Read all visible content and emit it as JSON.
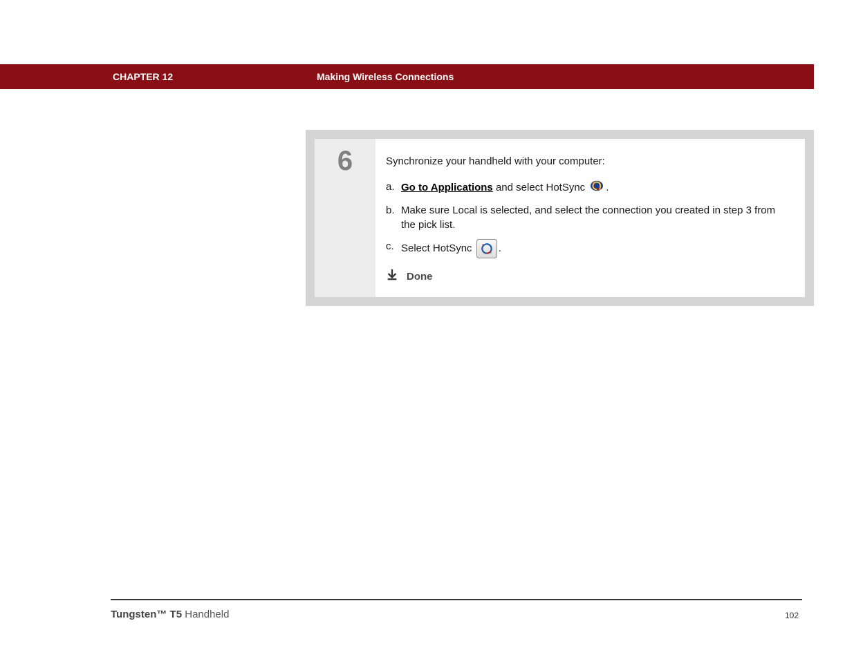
{
  "header": {
    "chapter": "CHAPTER 12",
    "title": "Making Wireless Connections"
  },
  "step": {
    "number": "6",
    "intro": "Synchronize your handheld with your computer:",
    "items": {
      "a": {
        "marker": "a.",
        "link": "Go to Applications",
        "after": " and select HotSync ",
        "period": "."
      },
      "b": {
        "marker": "b.",
        "text": "Make sure Local is selected, and select the connection you created in step 3 from the pick list."
      },
      "c": {
        "marker": "c.",
        "text_before": "Select HotSync ",
        "period": "."
      }
    },
    "done": "Done"
  },
  "footer": {
    "product_bold": "Tungsten™ T5",
    "product_rest": " Handheld",
    "page": "102"
  }
}
